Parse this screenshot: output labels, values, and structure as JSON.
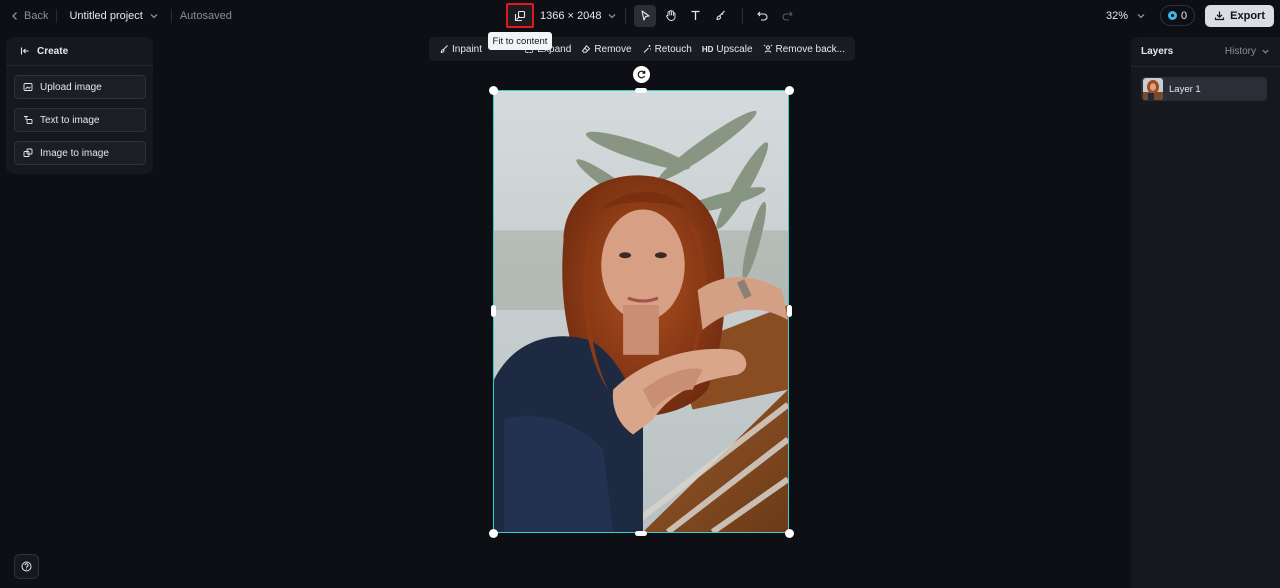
{
  "topbar": {
    "back_label": "Back",
    "project_name": "Untitled project",
    "save_status": "Autosaved",
    "canvas_size": "1366 × 2048",
    "zoom": "32%",
    "credits": "0",
    "export_label": "Export"
  },
  "tooltip": {
    "text": "Fit to content"
  },
  "tools": [
    {
      "name": "select-tool",
      "icon": "cursor-arrow-icon",
      "active": true
    },
    {
      "name": "hand-tool",
      "icon": "hand-icon",
      "active": false
    },
    {
      "name": "text-tool",
      "icon": "text-t-icon",
      "active": false
    },
    {
      "name": "brush-tool",
      "icon": "brush-icon",
      "active": false
    },
    {
      "name": "undo",
      "icon": "undo-icon",
      "active": false
    },
    {
      "name": "redo",
      "icon": "redo-icon",
      "active": false
    }
  ],
  "edit_toolbar": {
    "inpaint": "Inpaint",
    "expand": "Expand",
    "remove": "Remove",
    "retouch": "Retouch",
    "hd_badge": "HD",
    "upscale": "Upscale",
    "remove_background": "Remove back..."
  },
  "left_panel": {
    "title": "Create",
    "buttons": [
      "Upload image",
      "Text to image",
      "Image to image"
    ]
  },
  "right_panel": {
    "title": "Layers",
    "history_label": "History",
    "layers": [
      "Layer 1"
    ]
  },
  "colors": {
    "background": "#0d0f14",
    "panel": "#16181e",
    "selection": "#2fd1cb",
    "highlight_box": "#e01a1a",
    "export_bg": "#d9dde4"
  }
}
